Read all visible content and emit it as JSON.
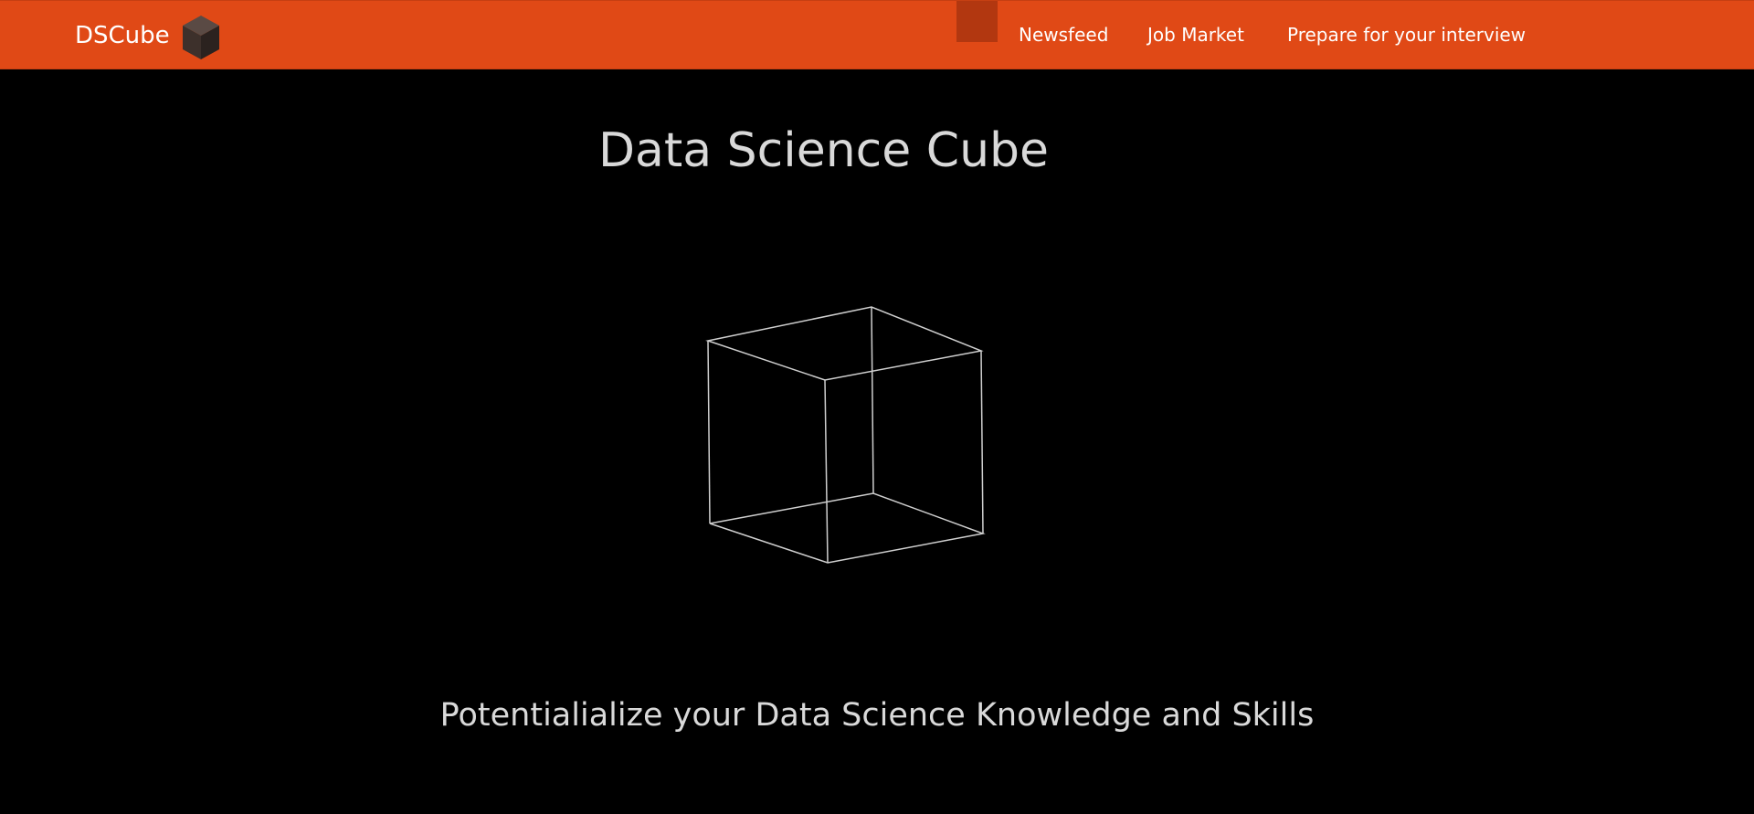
{
  "navbar": {
    "brand": "DSCube",
    "brand_logo_icon": "cube-logo-icon",
    "background_color": "#e04916",
    "links": [
      {
        "label": "Newsfeed"
      },
      {
        "label": "Job Market"
      },
      {
        "label": "Prepare for your interview"
      }
    ]
  },
  "hero": {
    "title": "Data Science Cube",
    "graphic_icon": "wireframe-cube-icon",
    "tagline": "Potentialialize your Data Science Knowledge and Skills"
  }
}
